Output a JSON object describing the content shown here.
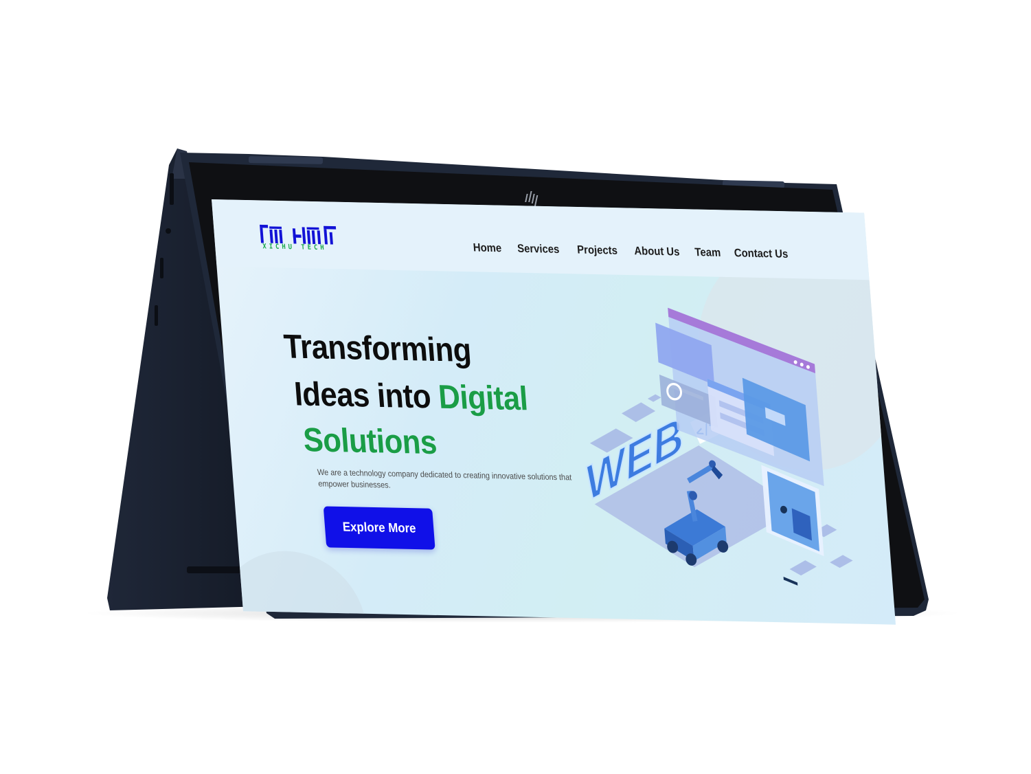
{
  "brand": {
    "logo_text": "XICHU TECH",
    "primary_color": "#1010e8",
    "accent_color": "#1a9d46"
  },
  "nav": {
    "items": [
      "Home",
      "Services",
      "Projects",
      "About Us",
      "Team",
      "Contact Us"
    ]
  },
  "hero": {
    "title_line1": "Transforming",
    "title_line2_a": "Ideas into ",
    "title_line2_b": "Digital",
    "title_line3": "Solutions",
    "description": "We are a technology company dedicated to creating innovative solutions that empower businesses.",
    "cta_label": "Explore More"
  },
  "illustration": {
    "web_label": "WEB",
    "code_label": "</>"
  },
  "device": {
    "logo": "hp-logo-icon",
    "body_color": "#1c2434",
    "bezel_color": "#0e0f12"
  }
}
